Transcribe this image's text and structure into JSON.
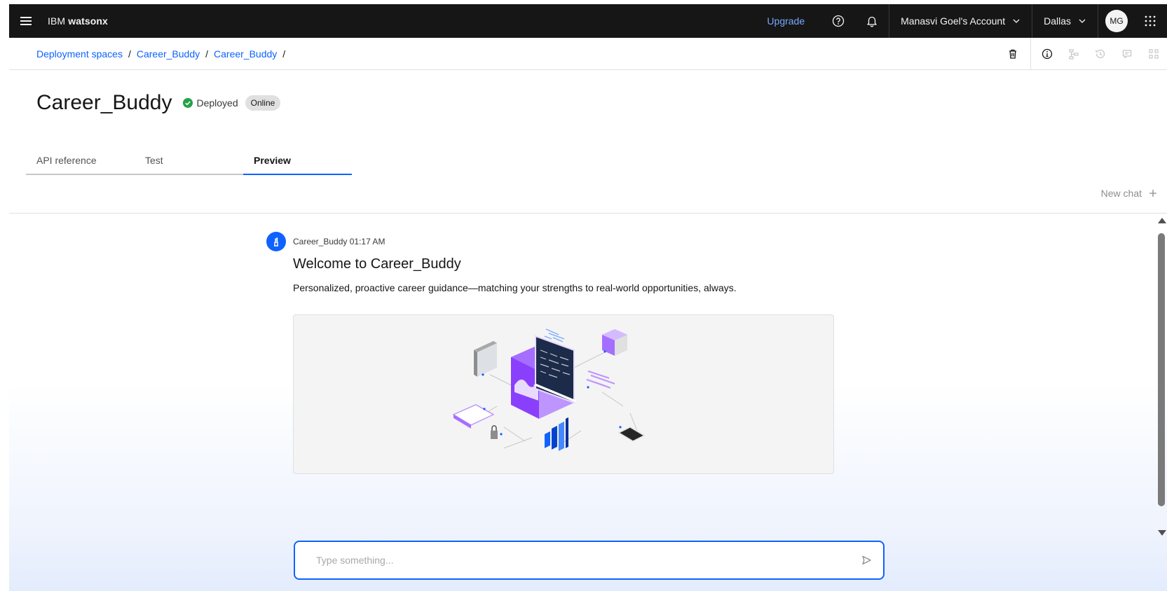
{
  "header": {
    "brand_prefix": "IBM",
    "brand_product": "watsonx",
    "upgrade_label": "Upgrade",
    "account_label": "Manasvi Goel's Account",
    "region_label": "Dallas",
    "avatar_initials": "MG"
  },
  "breadcrumb": {
    "items": [
      "Deployment spaces",
      "Career_Buddy",
      "Career_Buddy"
    ],
    "separator": "/"
  },
  "page": {
    "title": "Career_Buddy",
    "status_label": "Deployed",
    "tag_label": "Online"
  },
  "tabs": [
    {
      "label": "API reference",
      "active": false
    },
    {
      "label": "Test",
      "active": false
    },
    {
      "label": "Preview",
      "active": true
    }
  ],
  "chat": {
    "new_chat_label": "New chat",
    "message": {
      "author": "Career_Buddy",
      "time": "01:17 AM",
      "title": "Welcome to Career_Buddy",
      "text": "Personalized, proactive career guidance—matching your strengths to real-world opportunities, always."
    },
    "input_placeholder": "Type something..."
  },
  "colors": {
    "accent": "#0f62fe",
    "topbar": "#161616",
    "success": "#24a148",
    "upgrade": "#78a9ff"
  }
}
